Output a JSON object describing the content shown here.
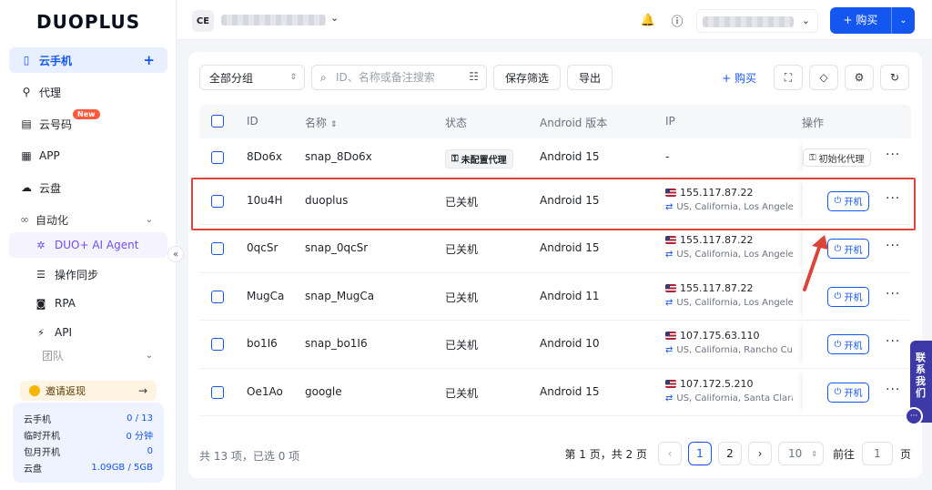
{
  "brand": {
    "logo_text": "DUOPLUS"
  },
  "sidebar": {
    "items": [
      {
        "label": "云手机",
        "icon": "phone-icon"
      },
      {
        "label": "代理",
        "icon": "proxy-icon"
      },
      {
        "label": "云号码",
        "icon": "number-icon",
        "badge": "New"
      },
      {
        "label": "APP",
        "icon": "apps-icon"
      },
      {
        "label": "云盘",
        "icon": "cloud-icon"
      }
    ],
    "automation": {
      "label": "自动化",
      "items": [
        {
          "label": "DUO+ AI Agent"
        },
        {
          "label": "操作同步"
        },
        {
          "label": "RPA"
        },
        {
          "label": "API"
        }
      ]
    },
    "team_label": "团队",
    "promo": {
      "label": "邀请返现",
      "arrow": "→"
    },
    "stats": [
      {
        "label": "云手机",
        "value": "0 / 13"
      },
      {
        "label": "临时开机",
        "value": "0 分钟"
      },
      {
        "label": "包月开机",
        "value": "0"
      },
      {
        "label": "云盘",
        "value": "1.09GB / 5GB"
      }
    ]
  },
  "topbar": {
    "workspace_initials": "CE",
    "buy_label": "购买"
  },
  "toolbar": {
    "group_select": "全部分组",
    "search_placeholder": "ID、名称或备注搜索",
    "save_filter": "保存筛选",
    "export": "导出",
    "buy_link": "购买"
  },
  "table": {
    "headers": {
      "id": "ID",
      "name": "名称",
      "status": "状态",
      "android": "Android 版本",
      "ip": "IP",
      "ops": "操作"
    },
    "rows": [
      {
        "id": "8Do6x",
        "name": "snap_8Do6x",
        "status": "未配置代理",
        "status_tag": true,
        "android": "Android 15",
        "ip": "-",
        "location": "",
        "action": "初始化代理"
      },
      {
        "id": "10u4H",
        "name": "duoplus",
        "status": "已关机",
        "android": "Android 15",
        "ip": "155.117.87.22",
        "location": "US, California, Los Angeles",
        "action": "开机"
      },
      {
        "id": "0qcSr",
        "name": "snap_0qcSr",
        "status": "已关机",
        "android": "Android 15",
        "ip": "155.117.87.22",
        "location": "US, California, Los Angeles",
        "action": "开机"
      },
      {
        "id": "MugCa",
        "name": "snap_MugCa",
        "status": "已关机",
        "android": "Android 11",
        "ip": "155.117.87.22",
        "location": "US, California, Los Angeles",
        "action": "开机"
      },
      {
        "id": "bo1I6",
        "name": "snap_bo1I6",
        "status": "已关机",
        "android": "Android 10",
        "ip": "107.175.63.110",
        "location": "US, California, Rancho Cucamonga",
        "action": "开机"
      },
      {
        "id": "Oe1Ao",
        "name": "google",
        "status": "已关机",
        "android": "Android 15",
        "ip": "107.172.5.210",
        "location": "US, California, Santa Clara",
        "action": "开机"
      }
    ]
  },
  "footer": {
    "summary": "共 13 项，已选 0 项",
    "page_info": "第 1 页，共 2 页",
    "pages": [
      "1",
      "2"
    ],
    "page_size": "10",
    "goto_label": "前往",
    "goto_value": "1",
    "page_unit": "页"
  },
  "contact_tab": "联系我们",
  "colors": {
    "accent": "#1456f0",
    "highlight": "#d9453a"
  }
}
